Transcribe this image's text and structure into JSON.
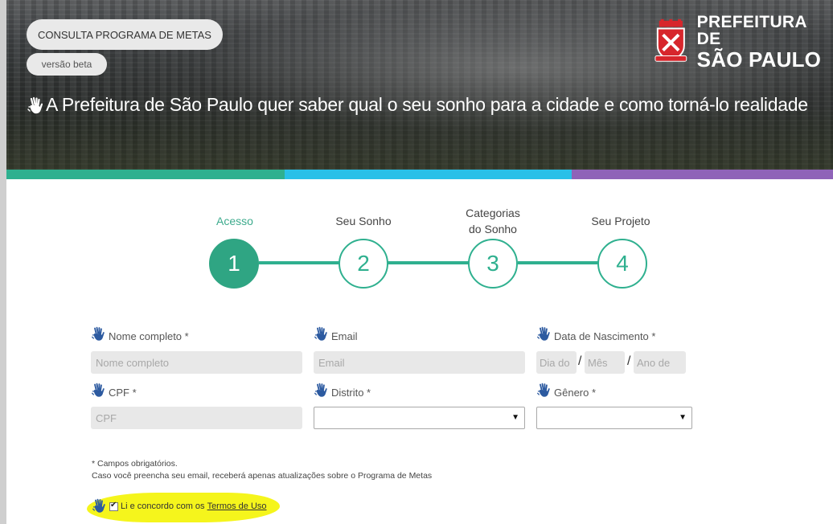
{
  "header": {
    "program_button": "CONSULTA PROGRAMA DE METAS",
    "beta_badge": "versão beta",
    "headline": "A Prefeitura de São Paulo quer saber qual o seu sonho para a cidade e como torná-lo realidade",
    "logo": {
      "line1": "PREFEITURA DE",
      "line2": "SÃO PAULO"
    }
  },
  "colors": {
    "green": "#2fb08f",
    "blue": "#29c0e8",
    "purple": "#8f63b8",
    "highlight": "#f5f51c"
  },
  "steps": [
    {
      "number": "1",
      "label": "Acesso",
      "active": true
    },
    {
      "number": "2",
      "label": "Seu Sonho",
      "active": false
    },
    {
      "number": "3",
      "label": "Categorias do Sonho",
      "active": false
    },
    {
      "number": "4",
      "label": "Seu Projeto",
      "active": false
    }
  ],
  "form": {
    "name": {
      "label": "Nome completo *",
      "placeholder": "Nome completo"
    },
    "email": {
      "label": "Email",
      "placeholder": "Email"
    },
    "birth": {
      "label": "Data de Nascimento *",
      "day_placeholder": "Dia do",
      "month_placeholder": "Mês",
      "year_placeholder": "Ano de",
      "separator": "/"
    },
    "cpf": {
      "label": "CPF *",
      "placeholder": "CPF"
    },
    "district": {
      "label": "Distrito *",
      "value": ""
    },
    "gender": {
      "label": "Gênero *",
      "value": ""
    },
    "note_line1": "* Campos obrigatórios.",
    "note_line2": "Caso você preencha seu email, receberá apenas atualizações sobre o Programa de Metas",
    "terms_text": "Li e concordo com os",
    "terms_link": "Termos de Uso"
  },
  "icons": [
    "sign-language-hand-icon",
    "city-coat-of-arms-icon",
    "dropdown-arrow-icon",
    "checkbox-check-icon"
  ]
}
